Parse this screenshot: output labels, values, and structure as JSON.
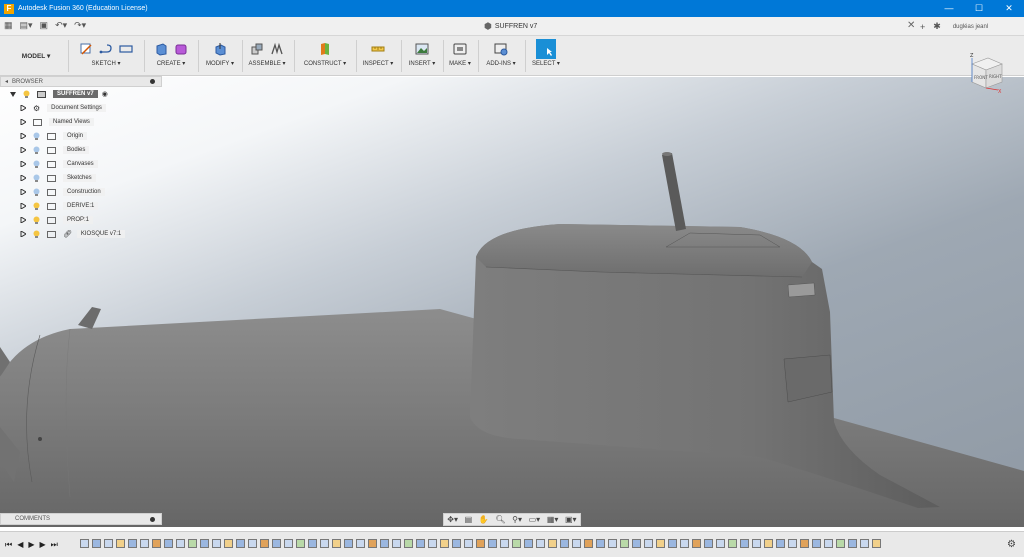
{
  "window": {
    "title": "Autodesk Fusion 360 (Education License)",
    "minimize": "—",
    "maximize": "☐",
    "close": "✕"
  },
  "tabs": {
    "document": "SUFFREN v7",
    "close": "✕",
    "add": "+",
    "user": "dugléas jeanl"
  },
  "toolbar": {
    "workspace": "MODEL ▾",
    "groups": [
      "SKETCH ▾",
      "CREATE ▾",
      "MODIFY ▾",
      "ASSEMBLE ▾",
      "CONSTRUCT ▾",
      "INSPECT ▾",
      "INSERT ▾",
      "MAKE ▾",
      "ADD-INS ▾",
      "SELECT ▾"
    ]
  },
  "browser": {
    "title": "BROWSER",
    "root": "SUFFREN v7",
    "items": [
      "Document Settings",
      "Named Views",
      "Origin",
      "Bodies",
      "Canvases",
      "Sketches",
      "Construction",
      "DERIVE:1",
      "PROP:1",
      "KIOSQUE v7:1"
    ]
  },
  "viewcube": {
    "top": "Z",
    "left_face": "FRONT",
    "right_face": "RIGHT",
    "x": "X"
  },
  "comments": {
    "title": "COMMENTS"
  },
  "colors": {
    "accent": "#0078d7",
    "select": "#1a8fd6",
    "hull": "#7d7d7d"
  }
}
